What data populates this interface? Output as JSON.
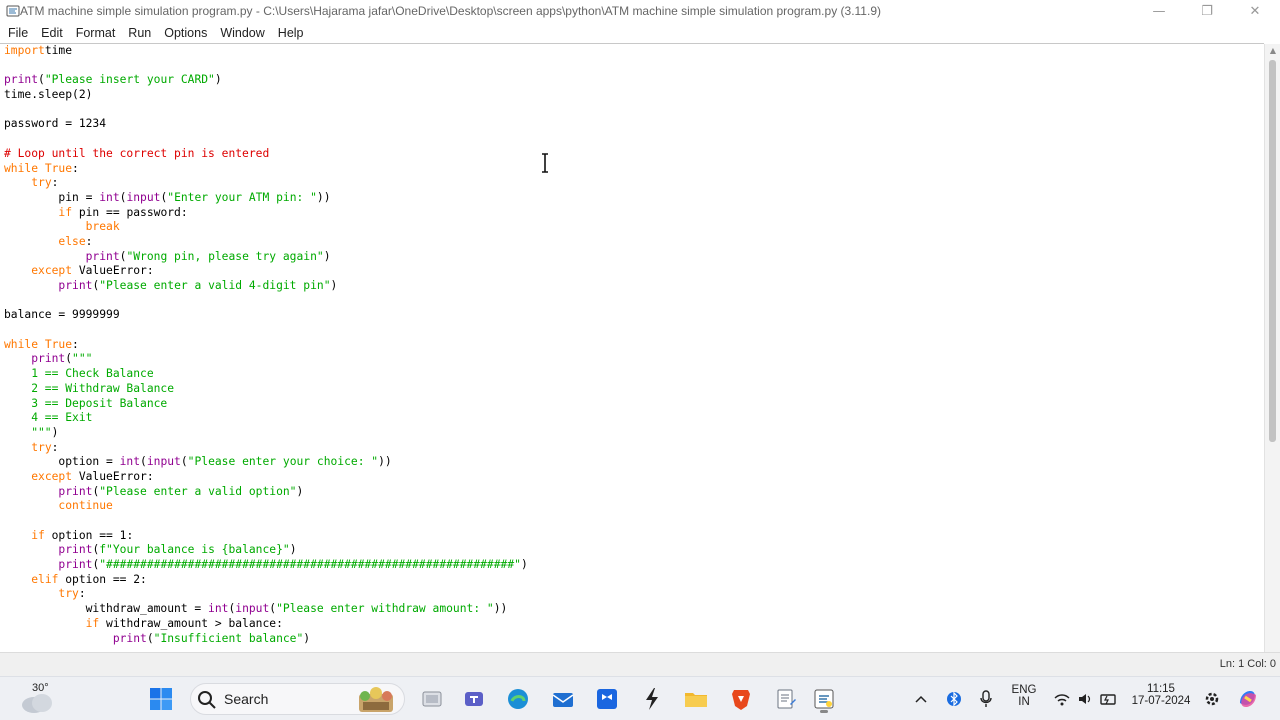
{
  "window": {
    "title": "ATM machine simple simulation program.py - C:\\Users\\Hajarama jafar\\OneDrive\\Desktop\\screen apps\\python\\ATM machine simple simulation program.py (3.11.9)",
    "minimize_glyph": "—",
    "maximize_glyph": "❐",
    "close_glyph": "✕"
  },
  "menu": [
    "File",
    "Edit",
    "Format",
    "Run",
    "Options",
    "Window",
    "Help"
  ],
  "editor": {
    "lines": [
      [
        [
          "kw",
          "import"
        ],
        [
          "",
          "time"
        ]
      ],
      [],
      [
        [
          "bi",
          "print"
        ],
        [
          "",
          "("
        ],
        [
          "st",
          "\"Please insert your CARD\""
        ],
        [
          "",
          ")"
        ]
      ],
      [
        [
          "",
          "time.sleep(2)"
        ]
      ],
      [],
      [
        [
          "",
          "password = 1234"
        ]
      ],
      [],
      [
        [
          "cm",
          "# Loop until the correct pin is entered"
        ]
      ],
      [
        [
          "kw",
          "while"
        ],
        [
          "",
          " "
        ],
        [
          "kw",
          "True"
        ],
        [
          "",
          ":"
        ]
      ],
      [
        [
          "",
          "    "
        ],
        [
          "kw",
          "try"
        ],
        [
          "",
          ":"
        ]
      ],
      [
        [
          "",
          "        pin = "
        ],
        [
          "bi",
          "int"
        ],
        [
          "",
          "("
        ],
        [
          "bi",
          "input"
        ],
        [
          "",
          "("
        ],
        [
          "st",
          "\"Enter your ATM pin: \""
        ],
        [
          "",
          "))"
        ]
      ],
      [
        [
          "",
          "        "
        ],
        [
          "kw",
          "if"
        ],
        [
          "",
          " pin == password:"
        ]
      ],
      [
        [
          "",
          "            "
        ],
        [
          "kw",
          "break"
        ]
      ],
      [
        [
          "",
          "        "
        ],
        [
          "kw",
          "else"
        ],
        [
          "",
          ":"
        ]
      ],
      [
        [
          "",
          "            "
        ],
        [
          "bi",
          "print"
        ],
        [
          "",
          "("
        ],
        [
          "st",
          "\"Wrong pin, please try again\""
        ],
        [
          "",
          ")"
        ]
      ],
      [
        [
          "",
          "    "
        ],
        [
          "kw",
          "except"
        ],
        [
          "",
          " ValueError:"
        ]
      ],
      [
        [
          "",
          "        "
        ],
        [
          "bi",
          "print"
        ],
        [
          "",
          "("
        ],
        [
          "st",
          "\"Please enter a valid 4-digit pin\""
        ],
        [
          "",
          ")"
        ]
      ],
      [],
      [
        [
          "",
          "balance = 9999999"
        ]
      ],
      [],
      [
        [
          "kw",
          "while"
        ],
        [
          "",
          " "
        ],
        [
          "kw",
          "True"
        ],
        [
          "",
          ":"
        ]
      ],
      [
        [
          "",
          "    "
        ],
        [
          "bi",
          "print"
        ],
        [
          "",
          "("
        ],
        [
          "st",
          "\"\"\""
        ]
      ],
      [
        [
          "st",
          "    1 == Check Balance"
        ]
      ],
      [
        [
          "st",
          "    2 == Withdraw Balance"
        ]
      ],
      [
        [
          "st",
          "    3 == Deposit Balance"
        ]
      ],
      [
        [
          "st",
          "    4 == Exit"
        ]
      ],
      [
        [
          "st",
          "    \"\"\""
        ],
        [
          "",
          ")"
        ]
      ],
      [
        [
          "",
          "    "
        ],
        [
          "kw",
          "try"
        ],
        [
          "",
          ":"
        ]
      ],
      [
        [
          "",
          "        option = "
        ],
        [
          "bi",
          "int"
        ],
        [
          "",
          "("
        ],
        [
          "bi",
          "input"
        ],
        [
          "",
          "("
        ],
        [
          "st",
          "\"Please enter your choice: \""
        ],
        [
          "",
          "))"
        ]
      ],
      [
        [
          "",
          "    "
        ],
        [
          "kw",
          "except"
        ],
        [
          "",
          " ValueError:"
        ]
      ],
      [
        [
          "",
          "        "
        ],
        [
          "bi",
          "print"
        ],
        [
          "",
          "("
        ],
        [
          "st",
          "\"Please enter a valid option\""
        ],
        [
          "",
          ")"
        ]
      ],
      [
        [
          "",
          "        "
        ],
        [
          "kw",
          "continue"
        ]
      ],
      [],
      [
        [
          "",
          "    "
        ],
        [
          "kw",
          "if"
        ],
        [
          "",
          " option == 1:"
        ]
      ],
      [
        [
          "",
          "        "
        ],
        [
          "bi",
          "print"
        ],
        [
          "",
          "("
        ],
        [
          "st",
          "f\"Your balance is {balance}\""
        ],
        [
          "",
          ")"
        ]
      ],
      [
        [
          "",
          "        "
        ],
        [
          "bi",
          "print"
        ],
        [
          "",
          "("
        ],
        [
          "st",
          "\"############################################################\""
        ],
        [
          "",
          ")"
        ]
      ],
      [
        [
          "",
          "    "
        ],
        [
          "kw",
          "elif"
        ],
        [
          "",
          " option == 2:"
        ]
      ],
      [
        [
          "",
          "        "
        ],
        [
          "kw",
          "try"
        ],
        [
          "",
          ":"
        ]
      ],
      [
        [
          "",
          "            withdraw_amount = "
        ],
        [
          "bi",
          "int"
        ],
        [
          "",
          "("
        ],
        [
          "bi",
          "input"
        ],
        [
          "",
          "("
        ],
        [
          "st",
          "\"Please enter withdraw amount: \""
        ],
        [
          "",
          "))"
        ]
      ],
      [
        [
          "",
          "            "
        ],
        [
          "kw",
          "if"
        ],
        [
          "",
          " withdraw_amount > balance:"
        ]
      ],
      [
        [
          "",
          "                "
        ],
        [
          "bi",
          "print"
        ],
        [
          "",
          "("
        ],
        [
          "st",
          "\"Insufficient balance\""
        ],
        [
          "",
          ")"
        ]
      ]
    ]
  },
  "statusbar": {
    "position": "Ln: 1  Col: 0"
  },
  "taskbar": {
    "temperature": "30°",
    "search_label": "Search",
    "language_line1": "ENG",
    "language_line2": "IN",
    "time": "11:15",
    "date": "17-07-2024"
  }
}
